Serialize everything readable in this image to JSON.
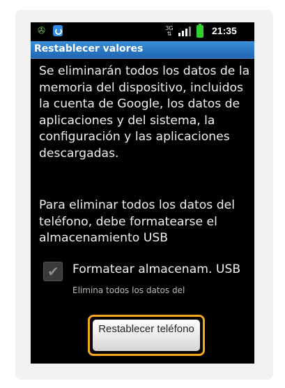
{
  "statusbar": {
    "time": "21:35",
    "network_text": "3G",
    "icons": [
      "usb-debug-icon",
      "sync-icon",
      "network-3g-icon",
      "signal-icon",
      "battery-icon"
    ]
  },
  "dialog": {
    "title": "Restablecer valores",
    "paragraph1": "Se eliminarán todos los datos de la memoria del dispositivo, incluidos la cuenta de Google, los datos de aplicaciones y del sistema, la configuración y las aplicaciones descargadas.",
    "paragraph2": "Para eliminar todos los datos del teléfono, debe formatearse el almacenamiento USB",
    "checkbox": {
      "label": "Formatear almacenam. USB",
      "sublabel": "Elimina todos los datos del",
      "checked": true
    },
    "button_label": "Restablecer teléfono"
  },
  "colors": {
    "titlebar": "#1f66b3",
    "highlight": "#f5a623",
    "battery": "#2ed02e"
  }
}
